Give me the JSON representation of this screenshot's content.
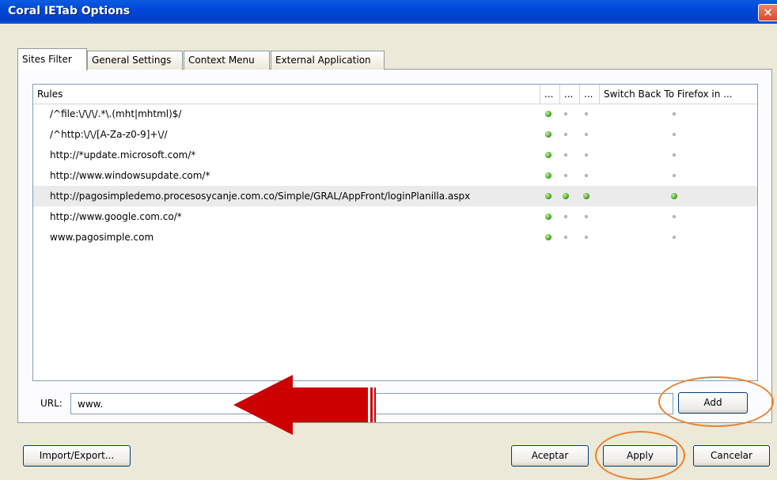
{
  "window": {
    "title": "Coral IETab Options",
    "close_glyph": "✕"
  },
  "tabs": [
    {
      "label": "Sites Filter",
      "active": true
    },
    {
      "label": "General Settings",
      "active": false
    },
    {
      "label": "Context Menu",
      "active": false
    },
    {
      "label": "External Application",
      "active": false
    }
  ],
  "list": {
    "columns": [
      "Rules",
      "...",
      "...",
      "...",
      "Switch Back To Firefox in ..."
    ],
    "rows": [
      {
        "rule": "/^file:\\/\\/\\/.*\\.(mht|mhtml)$/",
        "flags": [
          true,
          false,
          false,
          false
        ]
      },
      {
        "rule": "/^http:\\/\\/[A-Za-z0-9]+\\//",
        "flags": [
          true,
          false,
          false,
          false
        ]
      },
      {
        "rule": "http://*update.microsoft.com/*",
        "flags": [
          true,
          false,
          false,
          false
        ]
      },
      {
        "rule": "http://www.windowsupdate.com/*",
        "flags": [
          true,
          false,
          false,
          false
        ]
      },
      {
        "rule": "http://pagosimpledemo.procesosycanje.com.co/Simple/GRAL/AppFront/loginPlanilla.aspx",
        "flags": [
          true,
          true,
          true,
          true
        ],
        "selected": true
      },
      {
        "rule": "http://www.google.com.co/*",
        "flags": [
          true,
          false,
          false,
          false
        ]
      },
      {
        "rule": "www.pagosimple.com",
        "flags": [
          true,
          false,
          false,
          false
        ]
      }
    ]
  },
  "url": {
    "label": "URL:",
    "value": "www."
  },
  "buttons": {
    "add": "Add",
    "import_export": "Import/Export...",
    "accept": "Aceptar",
    "apply": "Apply",
    "cancel": "Cancelar"
  },
  "annotation": {
    "highlight_color": "#e9822e",
    "arrow_color": "#cc0000"
  }
}
